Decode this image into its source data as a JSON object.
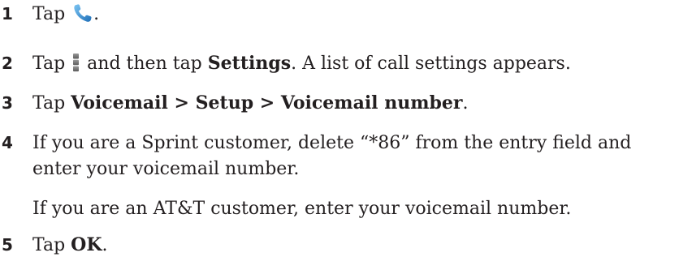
{
  "steps": [
    {
      "number": "1",
      "pre": "Tap",
      "icon": "phone-icon",
      "post": "."
    },
    {
      "number": "2",
      "pre": "Tap",
      "icon": "menu-icon",
      "mid": "and then tap",
      "bold": "Settings",
      "post": ". A list of call settings appears."
    },
    {
      "number": "3",
      "pre": "Tap",
      "bold": "Voicemail > Setup > Voicemail number",
      "post": "."
    },
    {
      "number": "4",
      "line1": "If you are a Sprint customer, delete “*86” from the entry field and",
      "line2": "enter your voicemail number.",
      "note": "If you are an AT&T customer, enter your voicemail number."
    },
    {
      "number": "5",
      "pre": "Tap",
      "bold": "OK",
      "post": "."
    }
  ],
  "colors": {
    "text": "#231f20",
    "phone_icon": "#3a8fd6"
  }
}
